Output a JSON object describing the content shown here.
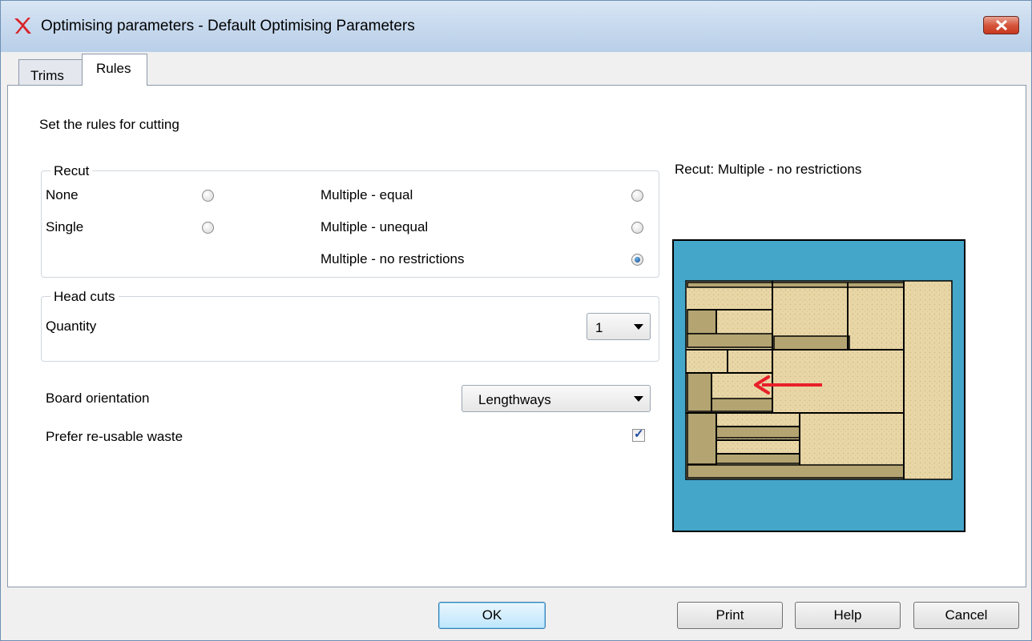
{
  "window": {
    "title": "Optimising parameters - Default Optimising Parameters",
    "app_icon": "red-x-icon",
    "close_icon": "close-icon"
  },
  "tabs": [
    {
      "label": "Trims",
      "active": false
    },
    {
      "label": "Rules",
      "active": true
    }
  ],
  "rules": {
    "heading": "Set the rules for cutting",
    "recut": {
      "legend": "Recut",
      "options": [
        {
          "label": "None",
          "checked": false
        },
        {
          "label": "Single",
          "checked": false
        },
        {
          "label": "Multiple - equal",
          "checked": false
        },
        {
          "label": "Multiple - unequal",
          "checked": false
        },
        {
          "label": "Multiple - no restrictions",
          "checked": true
        }
      ]
    },
    "head_cuts": {
      "legend": "Head cuts",
      "quantity_label": "Quantity",
      "quantity_value": "1"
    },
    "board_orientation": {
      "label": "Board orientation",
      "value": "Lengthways"
    },
    "prefer_reusable_waste": {
      "label": "Prefer re-usable waste",
      "checked": true
    },
    "preview_caption": "Recut: Multiple - no restrictions"
  },
  "buttons": {
    "ok": "OK",
    "print": "Print",
    "help": "Help",
    "cancel": "Cancel"
  },
  "colors": {
    "preview_background": "#44a6c9",
    "board_fill": "#e8d6a6",
    "waste_fill": "#b3a472",
    "arrow": "#e8202a"
  }
}
